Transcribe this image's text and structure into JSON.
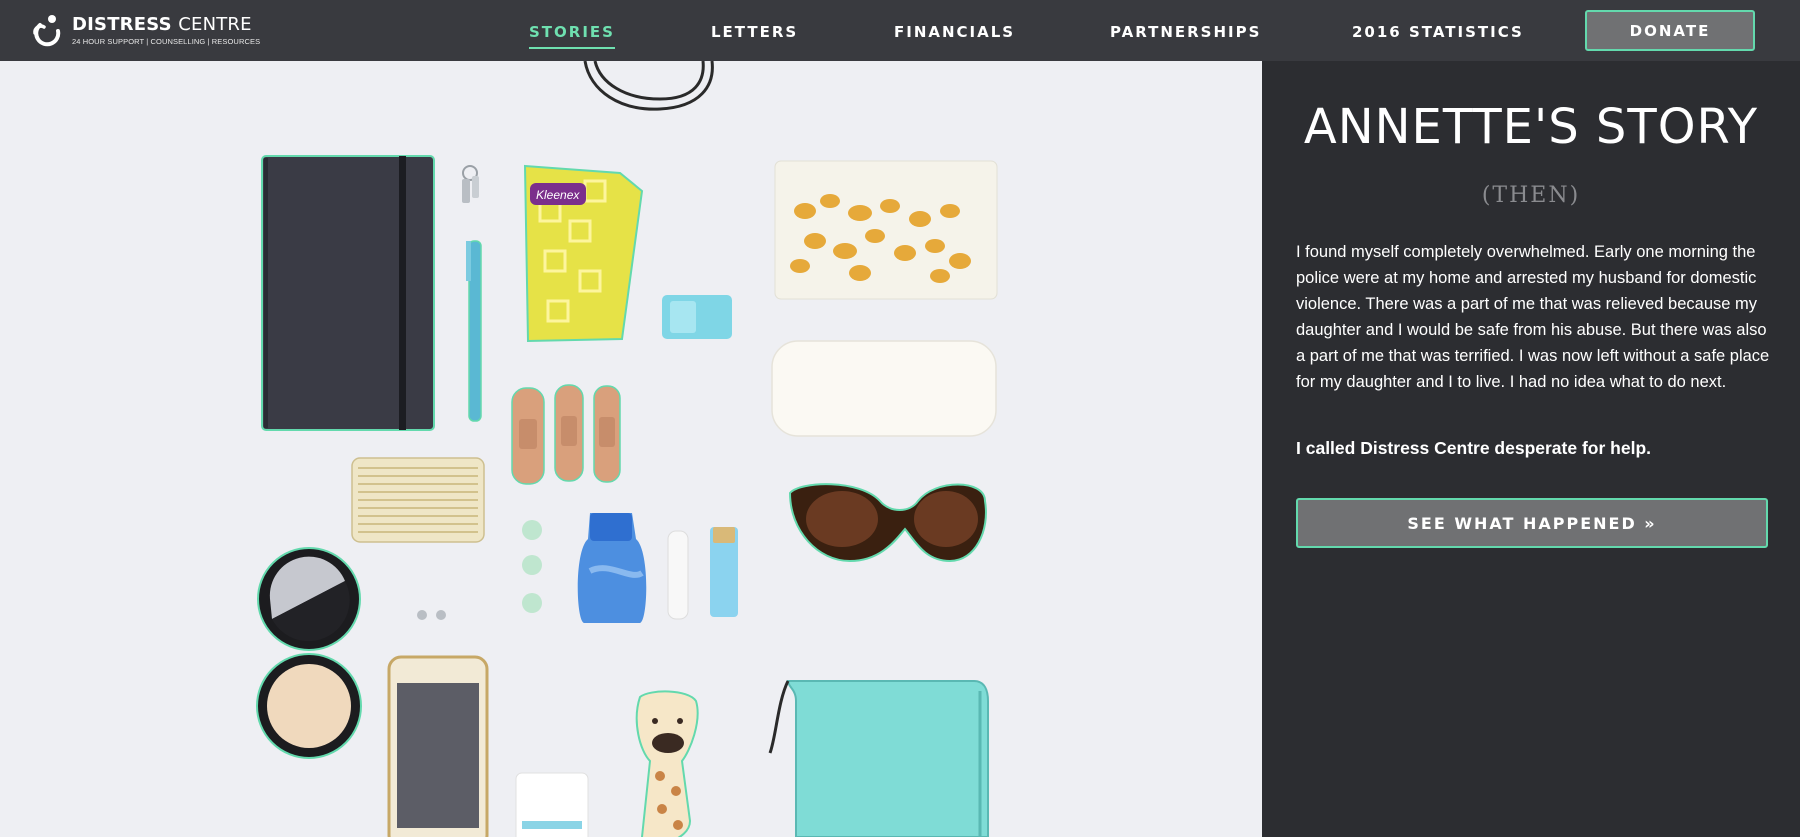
{
  "header": {
    "logo_bold": "DISTRESS",
    "logo_light": "CENTRE",
    "logo_tagline": "24 HOUR SUPPORT | COUNSELLING | RESOURCES",
    "nav": [
      {
        "label": "STORIES",
        "active": true
      },
      {
        "label": "LETTERS",
        "active": false
      },
      {
        "label": "FINANCIALS",
        "active": false
      },
      {
        "label": "PARTNERSHIPS",
        "active": false
      },
      {
        "label": "2016 STATISTICS",
        "active": false
      }
    ],
    "donate_label": "DONATE"
  },
  "photo": {
    "items": [
      "notebook-icon",
      "keys-icon",
      "pen-icon",
      "tissues-icon",
      "hair-clip-icon",
      "crackers-bag-icon",
      "glasses-case-icon",
      "bandages-icon",
      "business-card-case-icon",
      "mints-icon",
      "lotion-bottle-icon",
      "lip-balm-icon",
      "sunglasses-icon",
      "compact-mirror-icon",
      "earrings-icon",
      "smartphone-icon",
      "hand-cream-icon",
      "toy-giraffe-icon",
      "wallet-icon",
      "purse-strap-icon"
    ],
    "tissue_brand": "Kleenex"
  },
  "story": {
    "title": "ANNETTE'S STORY",
    "subtitle": "(THEN)",
    "body": "I found myself completely overwhelmed. Early one morning the police were at my home and arrested my husband for domestic violence. There was a part of me that was relieved because my daughter and I would be safe from his abuse. But there was also a part of me that was terrified. I was now left without a safe place for my daughter and I to live. I had no idea what to do next.",
    "emphasis": "I called Distress Centre desperate for help.",
    "cta_label": "SEE WHAT HAPPENED »"
  },
  "colors": {
    "accent": "#63d9ad",
    "header_bg": "#393a3f",
    "panel_bg": "#2c2d31",
    "photo_bg": "#eeeff3"
  }
}
